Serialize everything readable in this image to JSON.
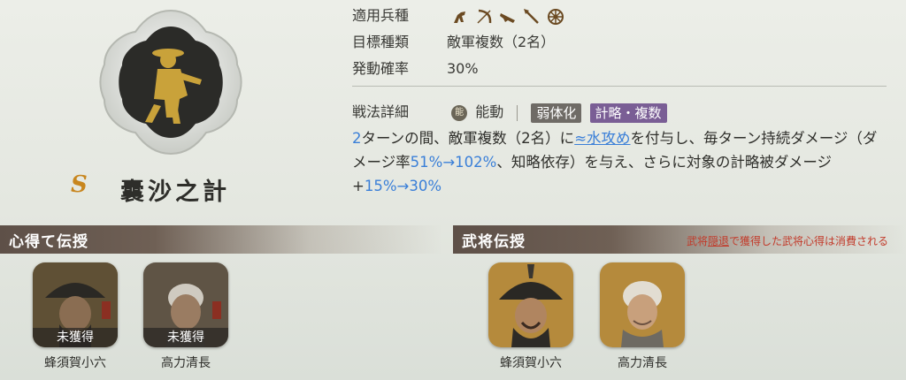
{
  "skill": {
    "rank": "S",
    "name": "囊沙之計",
    "unit_types_label": "適用兵種",
    "unit_types_icons": [
      "cavalry-icon",
      "bow-icon",
      "gun-icon",
      "spear-icon",
      "siege-wheel-icon"
    ],
    "target_label": "目標種類",
    "target_value": "敵軍複数（2名）",
    "rate_label": "発動確率",
    "rate_value": "30%",
    "detail_label": "戦法詳細",
    "type_mark": "能",
    "type_value": "能動",
    "tags": [
      "弱体化",
      "計略・複数"
    ],
    "description": {
      "p1": "2",
      "p2": "ターンの間、敵軍複数（2名）に",
      "p3": "≈水攻め",
      "p4": "を付与し、毎ターン持続ダメージ（ダメージ率",
      "p5": "51%→102%",
      "p6": "、知略依存）を与え、さらに対象の計略被ダメージ+",
      "p7": "15%→30%"
    }
  },
  "panels": {
    "left": {
      "title": "心得て伝授",
      "cards": [
        {
          "name": "蜂須賀小六",
          "status": "未獲得"
        },
        {
          "name": "高力清長",
          "status": "未獲得"
        }
      ]
    },
    "right": {
      "title": "武将伝授",
      "note_pre": "武将",
      "note_u": "隠退",
      "note_post": "で獲得した武将心得は消費される",
      "cards": [
        {
          "name": "蜂須賀小六"
        },
        {
          "name": "高力清長"
        }
      ]
    }
  },
  "colors": {
    "highlight": "#3a7fd8",
    "rank": "#c8861e",
    "tag_gray": "#6f6b66",
    "tag_purple": "#7a5e95",
    "note_red": "#c23a2a"
  }
}
